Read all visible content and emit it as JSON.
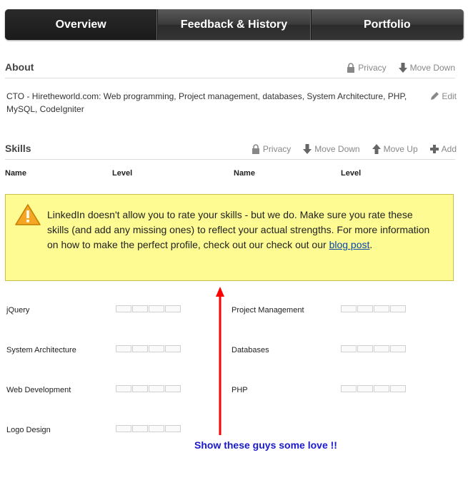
{
  "tabs": [
    {
      "label": "Overview"
    },
    {
      "label": "Feedback & History"
    },
    {
      "label": "Portfolio"
    }
  ],
  "about": {
    "title": "About",
    "privacy": "Privacy",
    "move_down": "Move Down",
    "text": "CTO - Hiretheworld.com: Web programming, Project management, databases, System Architecture, PHP, MySQL, CodeIgniter",
    "edit": "Edit"
  },
  "skills": {
    "title": "Skills",
    "privacy": "Privacy",
    "move_down": "Move Down",
    "move_up": "Move Up",
    "add": "Add",
    "col_name": "Name",
    "col_level": "Level",
    "warning_text": "LinkedIn doesn't allow you to rate your skills - but we do. Make sure you rate these skills (and add any missing ones) to reflect your actual strengths. For more information on how to make the perfect profile, check out our check out our ",
    "warning_link": "blog post",
    "warning_end": ".",
    "items": [
      {
        "name": "jQuery"
      },
      {
        "name": "Project Management"
      },
      {
        "name": "System Architecture"
      },
      {
        "name": "Databases"
      },
      {
        "name": "Web Development"
      },
      {
        "name": "PHP"
      },
      {
        "name": "Logo Design"
      }
    ]
  },
  "annotation": {
    "text": "Show these guys some love !!",
    "color": "#1a1acc",
    "arrow_color": "#ff0000"
  }
}
